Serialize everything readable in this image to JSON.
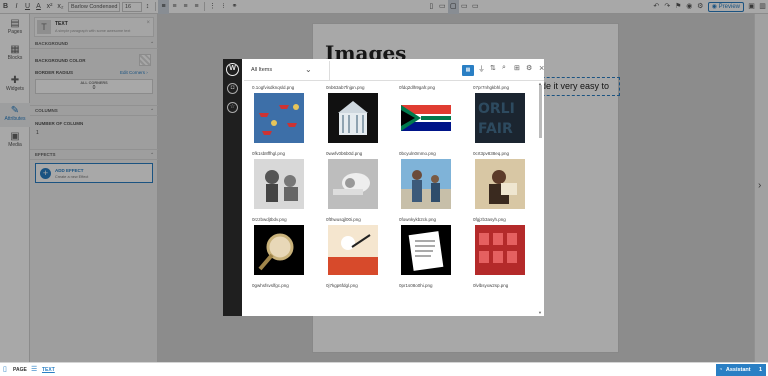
{
  "toolbar": {
    "font": "Barlow Condensed",
    "size": "16",
    "preview_label": "Preview",
    "format_glyphs": [
      "B",
      "I",
      "U",
      "A",
      "x²",
      "x₂"
    ]
  },
  "nav": [
    "Pages",
    "Blocks",
    "Widgets",
    "Attributes",
    "Media"
  ],
  "panel": {
    "element_title": "TEXT",
    "element_desc": "A simple paragraph with some awesome text",
    "background_header": "BACKGROUND",
    "background_color_label": "BACKGROUND COLOR",
    "border_radius_label": "BORDER RADIUS",
    "edit_corners_label": "Edit Corners",
    "all_corners_label": "ALL CORNERS",
    "all_corners_value": "0",
    "columns_header": "COLUMNS",
    "number_of_columns_label": "NUMBER OF COLUMN",
    "number_of_columns_value": "1",
    "effects_header": "EFFECTS",
    "add_effect_title": "ADD EFFECT",
    "add_effect_sub": "Create a new Effect"
  },
  "document": {
    "heading": "Images",
    "text_snippet": "de it very easy to"
  },
  "status": {
    "page_label": "PAGE",
    "text_label": "TEXT",
    "assistant_label": "Assistant",
    "assistant_count": "1"
  },
  "modal": {
    "filter_label": "All Items",
    "items": [
      {
        "name": "0.1ogfvisdknqsld.png",
        "kind": "boats"
      },
      {
        "name": "0nb63ab7fnjpn.png",
        "kind": "bank"
      },
      {
        "name": "0fdq2dlh9gafr.png",
        "kind": "flag"
      },
      {
        "name": "07pr7nhgkbhl.png",
        "kind": "orwell"
      },
      {
        "name": "0fk1sb8ffhgl.png",
        "kind": "gym"
      },
      {
        "name": "0wwfv0b6b0d.png",
        "kind": "toilet-paper"
      },
      {
        "name": "0bcyuln0mmo.png",
        "kind": "people"
      },
      {
        "name": "0crt3pv838eq.png",
        "kind": "reader"
      },
      {
        "name": "0rzzbwdjtbdv.png",
        "kind": "magnifier"
      },
      {
        "name": "0fthwusqjl00i.png",
        "kind": "pen-cartoon"
      },
      {
        "name": "0fownkykb2ck.png",
        "kind": "document"
      },
      {
        "name": "0fgjzb3asyh.png",
        "kind": "theatre"
      },
      {
        "name": "0gwhsfsvslfgc.png",
        "kind": "none"
      },
      {
        "name": "0j7kgp6fdgl.png",
        "kind": "none"
      },
      {
        "name": "0pr1s08o0hi.png",
        "kind": "none"
      },
      {
        "name": "0lvlbsyxw2sp.png",
        "kind": "none"
      }
    ]
  },
  "colors": {
    "accent": "#2a7fc4",
    "modal_sidebar": "#1f1f1f"
  }
}
